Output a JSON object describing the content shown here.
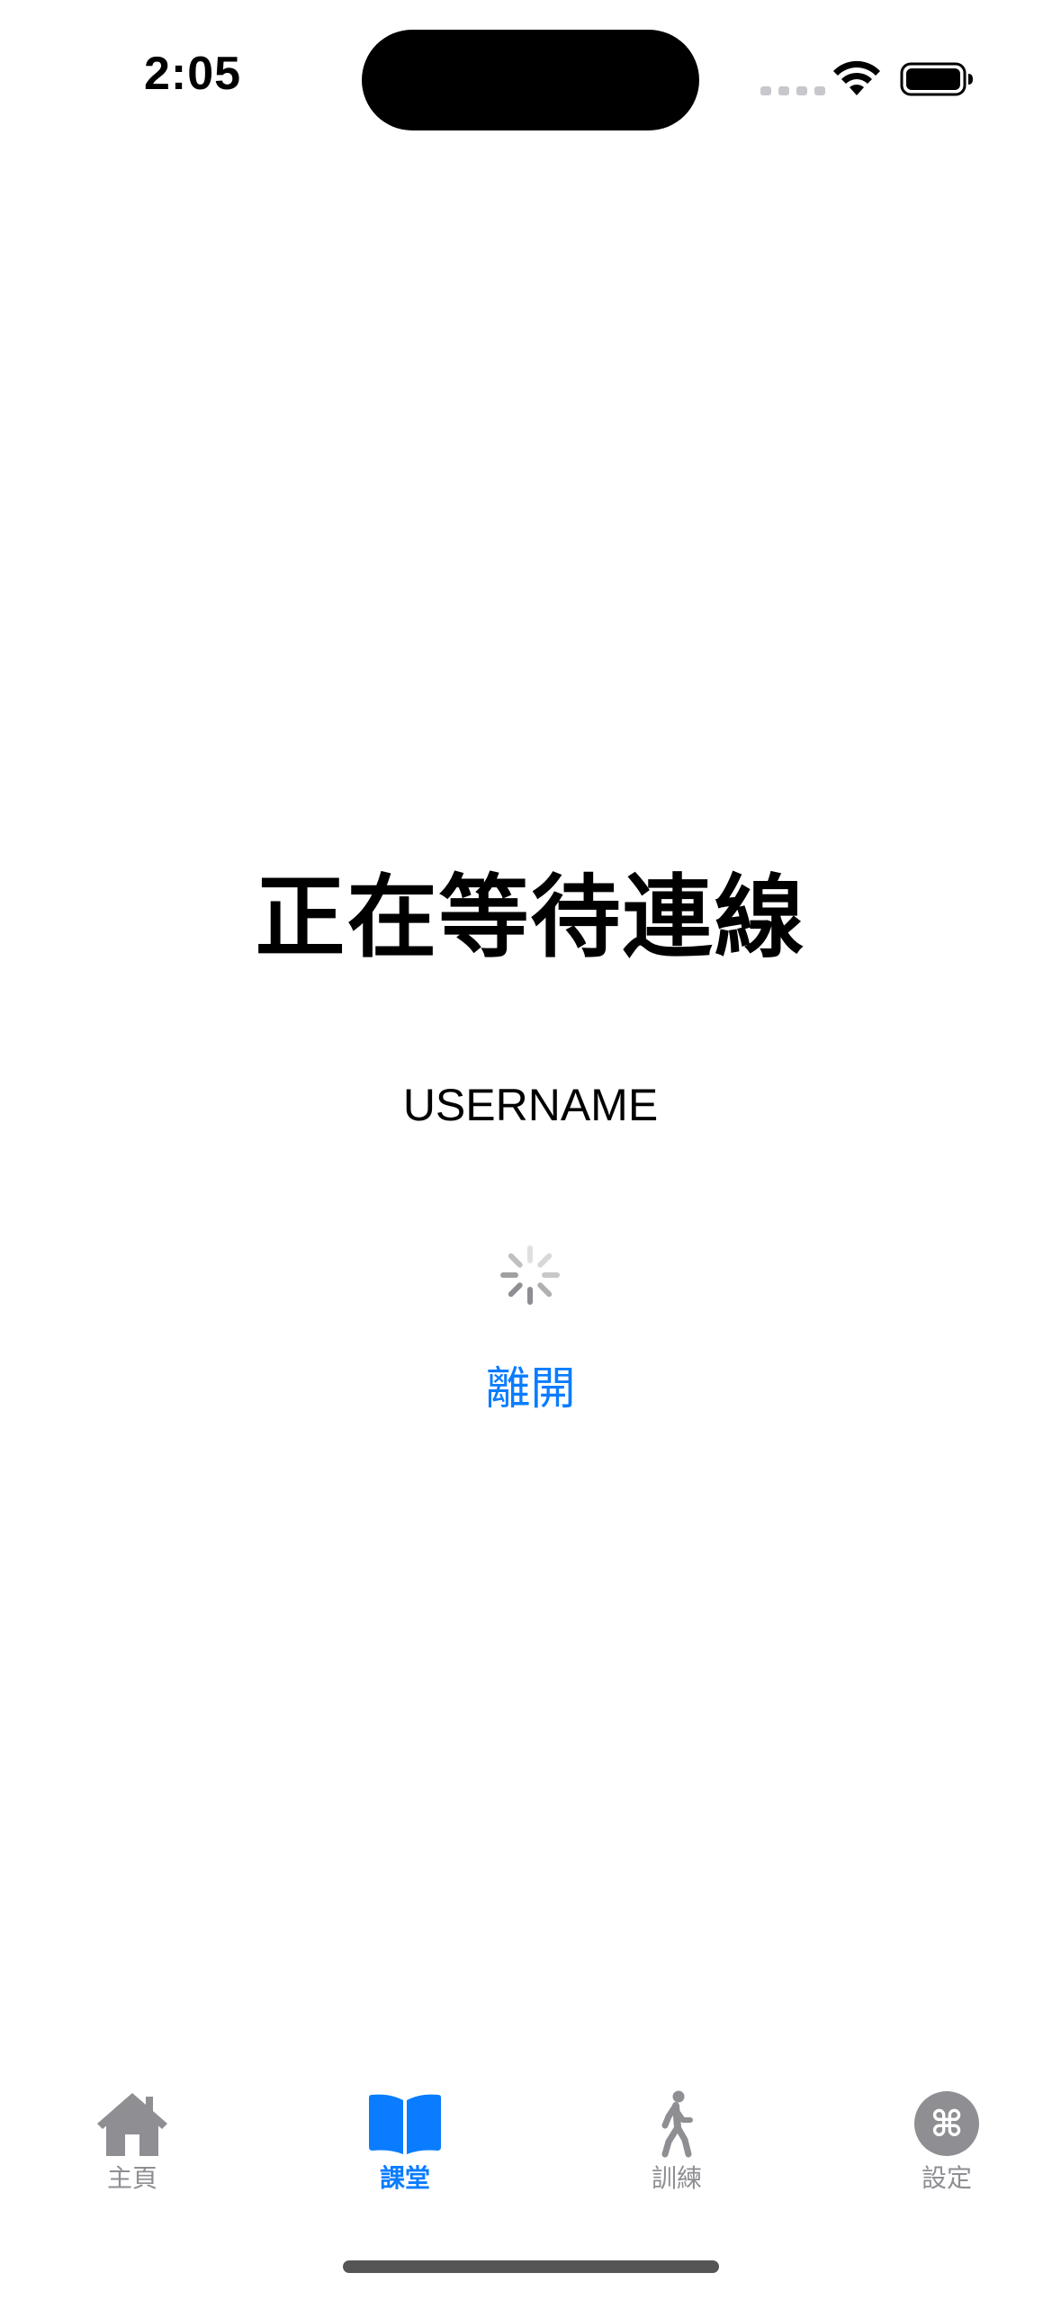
{
  "status_bar": {
    "time": "2:05"
  },
  "main": {
    "title": "正在等待連線",
    "username": "USERNAME",
    "leave_label": "離開"
  },
  "tab_bar": {
    "tabs": [
      {
        "label": "主頁",
        "icon": "house-icon",
        "active": false
      },
      {
        "label": "課堂",
        "icon": "book-icon",
        "active": true
      },
      {
        "label": "訓練",
        "icon": "walking-figure-icon",
        "active": false
      },
      {
        "label": "設定",
        "icon": "command-icon",
        "active": false
      }
    ]
  },
  "colors": {
    "accent": "#0a7cff",
    "inactive": "#8e8e93"
  }
}
